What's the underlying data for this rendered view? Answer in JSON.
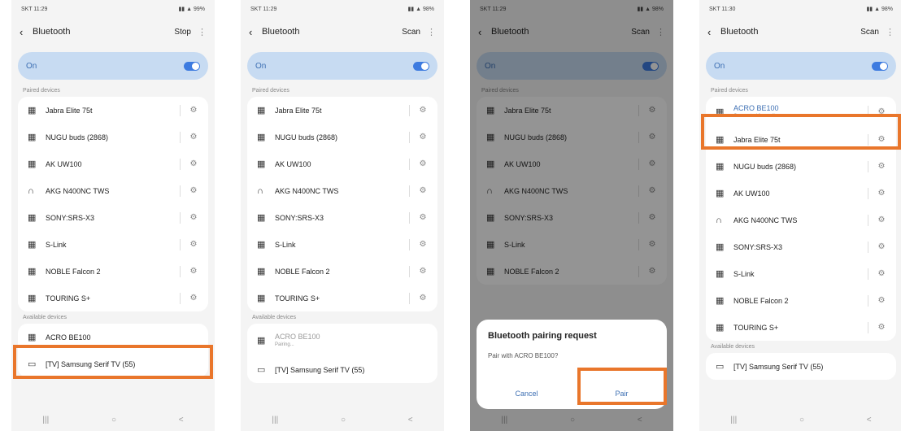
{
  "screens": [
    {
      "status_time": "SKT 11:29",
      "status_icons": "▮▮ ▲ 99%",
      "title": "Bluetooth",
      "action": "Stop",
      "on_label": "On",
      "paired_label": "Paired devices",
      "paired": [
        "Jabra Elite 75t",
        "NUGU buds (2868)",
        "AK UW100",
        "AKG N400NC TWS",
        "SONY:SRS-X3",
        "S-Link",
        "NOBLE Falcon 2",
        "TOURING S+"
      ],
      "available_label": "Available devices",
      "available": [
        "ACRO BE100",
        "[TV] Samsung Serif TV (55)"
      ]
    },
    {
      "status_time": "SKT 11:29",
      "status_icons": "▮▮ ▲ 98%",
      "title": "Bluetooth",
      "action": "Scan",
      "on_label": "On",
      "paired_label": "Paired devices",
      "paired": [
        "Jabra Elite 75t",
        "NUGU buds (2868)",
        "AK UW100",
        "AKG N400NC TWS",
        "SONY:SRS-X3",
        "S-Link",
        "NOBLE Falcon 2",
        "TOURING S+"
      ],
      "available_label": "Available devices",
      "available": [
        "ACRO BE100",
        "[TV] Samsung Serif TV (55)"
      ],
      "available_sub": "Pairing..."
    },
    {
      "status_time": "SKT 11:29",
      "status_icons": "▮▮ ▲ 98%",
      "title": "Bluetooth",
      "action": "Scan",
      "on_label": "On",
      "paired_label": "Paired devices",
      "paired": [
        "Jabra Elite 75t",
        "NUGU buds (2868)",
        "AK UW100",
        "AKG N400NC TWS",
        "SONY:SRS-X3",
        "S-Link",
        "NOBLE Falcon 2"
      ],
      "dialog_title": "Bluetooth pairing request",
      "dialog_message": "Pair with ACRO BE100?",
      "cancel": "Cancel",
      "pair": "Pair"
    },
    {
      "status_time": "SKT 11:30",
      "status_icons": "▮▮ ▲ 98%",
      "title": "Bluetooth",
      "action": "Scan",
      "on_label": "On",
      "paired_label": "Paired devices",
      "paired": [
        "ACRO BE100",
        "Jabra Elite 75t",
        "NUGU buds (2868)",
        "AK UW100",
        "AKG N400NC TWS",
        "SONY:SRS-X3",
        "S-Link",
        "NOBLE Falcon 2",
        "TOURING S+"
      ],
      "paired_sub": "Connected for audio",
      "available_label": "Available devices",
      "available": [
        "[TV] Samsung Serif TV (55)"
      ]
    }
  ],
  "nav": {
    "recent": "|||",
    "home": "○",
    "back": "<"
  },
  "icons": {
    "back": "‹",
    "more": "⋮",
    "gear": "⚙",
    "device": "▦",
    "headphones": "∩",
    "tv": "▭"
  },
  "highlight_color": "#e9762b"
}
